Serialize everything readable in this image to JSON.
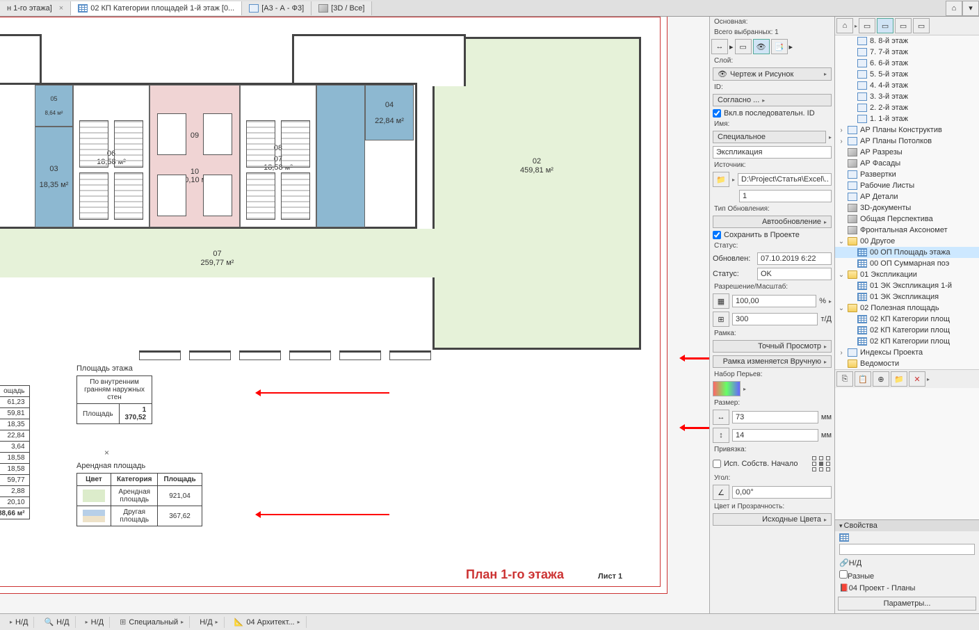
{
  "tabs": [
    {
      "label": "н 1-го этажа]"
    },
    {
      "label": "02 КП Категории площадей 1-й этаж [0..."
    },
    {
      "label": "[А3 - А - Ф3]"
    },
    {
      "label": "[3D / Все]"
    }
  ],
  "panel": {
    "mainLabel": "Основная:",
    "selectedCount": "Всего выбранных: 1",
    "layerLabel": "Слой:",
    "layerValue": "Чертеж и Рисунок",
    "idLabel": "ID:",
    "idValue": "Согласно ...",
    "seqCheckbox": "Вкл.в последовательн. ID",
    "nameLabel": "Имя:",
    "nameSelect": "Специальное",
    "nameValue": "Экспликация",
    "sourceLabel": "Источник:",
    "sourcePath": "D:\\Project\\Статья\\Excel\\...",
    "sourceNum": "1",
    "updateTypeLabel": "Тип Обновления:",
    "updateType": "Автообновление",
    "saveInProject": "Сохранить в Проекте",
    "statusLabel": "Статус:",
    "updatedLabel": "Обновлен:",
    "updatedValue": "07.10.2019 6:22",
    "statusLabel2": "Статус:",
    "statusValue": "OK",
    "resLabel": "Разрешение/Масштаб:",
    "resPercent": "100,00",
    "resUnit": "%",
    "scale": "300",
    "scaleUnit": "т/Д",
    "frameLabel": "Рамка:",
    "frameType": "Точный Просмотр",
    "frameManual": "Рамка изменяется Вручную",
    "penLabel": "Набор Перьев:",
    "sizeLabel": "Размер:",
    "sizeW": "73",
    "sizeH": "14",
    "sizeUnit": "мм",
    "anchorLabel": "Привязка:",
    "anchorCheck": "Исп. Собств. Начало",
    "angleLabel": "Угол:",
    "angleValue": "0,00°",
    "colorLabel": "Цвет и Прозрачность:",
    "colorValue": "Исходные Цвета"
  },
  "tree": {
    "floors": [
      "8. 8-й этаж",
      "7. 7-й этаж",
      "6. 6-й этаж",
      "5. 5-й этаж",
      "4. 4-й этаж",
      "3. 3-й этаж",
      "2. 2-й этаж",
      "1. 1-й этаж"
    ],
    "groups": [
      {
        "label": "АР Планы Конструктив",
        "exp": ">"
      },
      {
        "label": "АР Планы Потолков",
        "exp": ">"
      },
      {
        "label": "АР Разрезы",
        "icon": "3d"
      },
      {
        "label": "АР Фасады",
        "icon": "3d"
      },
      {
        "label": "Развертки",
        "icon": "page"
      },
      {
        "label": "Рабочие Листы",
        "icon": "page"
      },
      {
        "label": "АР Детали",
        "icon": "page"
      },
      {
        "label": "3D-документы",
        "icon": "3d"
      },
      {
        "label": "Общая Перспектива",
        "icon": "3d"
      },
      {
        "label": "Фронтальная Аксономет",
        "icon": "3d"
      }
    ],
    "other": "00 Другое",
    "schedules": [
      {
        "label": "00 ОП Площадь этажа",
        "sel": true
      },
      {
        "label": "00 ОП Суммарная поэ"
      }
    ],
    "expl": "01 Экспликации",
    "explItems": [
      "01 ЭК Экспликация 1-й",
      "01 ЭК Экспликация"
    ],
    "useful": "02 Полезная площадь",
    "usefulItems": [
      "02 КП Категории площ",
      "02 КП Категории площ",
      "02 КП Категории площ"
    ],
    "bottom": [
      "Индексы Проекта",
      "Ведомости"
    ]
  },
  "props": {
    "title": "Свойства",
    "nd": "Н/Д",
    "diff": "Разные",
    "proj": "04 Проект - Планы",
    "params": "Параметры..."
  },
  "drawing": {
    "floorAreaTitle": "Площадь этажа",
    "floorAreaSub": "По внутренним гранням наружных стен",
    "floorAreaLabel": "Площадь",
    "floorAreaValue": "1 370,52",
    "rentTitle": "Арендная площадь",
    "colColor": "Цвет",
    "colCat": "Категория",
    "colArea": "Площадь",
    "rentCat": "Арендная площадь",
    "rentVal": "921,04",
    "otherCat": "Другая площадь",
    "otherVal": "367,62",
    "planTitle": "План 1-го этажа",
    "sheetNo": "Лист 1",
    "rooms": {
      "r02": {
        "n": "02",
        "a": "459,81 м²"
      },
      "r03": {
        "n": "03",
        "a": "18,35 м²"
      },
      "r04": {
        "n": "04",
        "a": "22,84 м²"
      },
      "r05": {
        "n": "05",
        "a": "8,64 м²"
      },
      "r06": {
        "n": "06",
        "a": "18,58 м²"
      },
      "r07": {
        "n": "07",
        "a": "18,58 м²"
      },
      "r07b": {
        "n": "07",
        "a": "259,77 м²"
      },
      "r09": {
        "n": "09"
      },
      "r08": {
        "n": "08"
      },
      "r10": {
        "n": "10",
        "a": "20,10 м²"
      }
    },
    "sideValues": [
      "ощадь",
      "61,23",
      "59,81",
      "18,35",
      "22,84",
      "3,64",
      "18,58",
      "18,58",
      "59,77",
      "2,88",
      "20,10",
      "88,66 м²"
    ]
  },
  "status": {
    "nd": "Н/Д",
    "special": "Специальный",
    "arch": "04 Архитект..."
  }
}
